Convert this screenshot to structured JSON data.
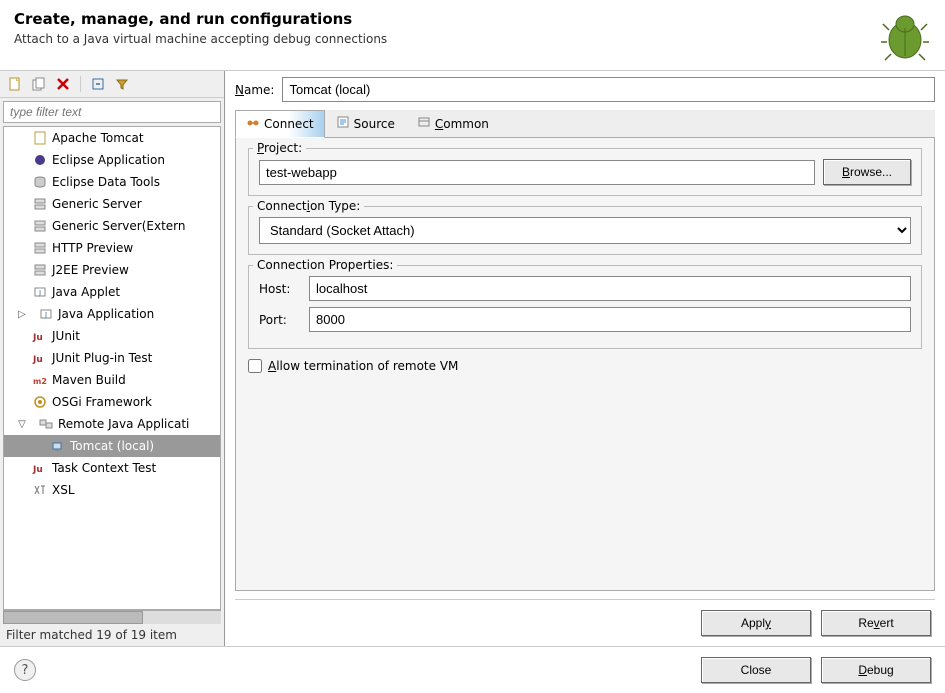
{
  "header": {
    "title": "Create, manage, and run configurations",
    "subtitle": "Attach to a Java virtual machine accepting debug connections"
  },
  "sidebar": {
    "filter_placeholder": "type filter text",
    "items": [
      {
        "label": "Apache Tomcat",
        "level": 0
      },
      {
        "label": "Eclipse Application",
        "level": 0
      },
      {
        "label": "Eclipse Data Tools",
        "level": 0
      },
      {
        "label": "Generic Server",
        "level": 0
      },
      {
        "label": "Generic Server(Extern",
        "level": 0
      },
      {
        "label": "HTTP Preview",
        "level": 0
      },
      {
        "label": "J2EE Preview",
        "level": 0
      },
      {
        "label": "Java Applet",
        "level": 0
      },
      {
        "label": "Java Application",
        "level": 0,
        "expandable": true,
        "expanded": false
      },
      {
        "label": "JUnit",
        "level": 0
      },
      {
        "label": "JUnit Plug-in Test",
        "level": 0
      },
      {
        "label": "Maven Build",
        "level": 0
      },
      {
        "label": "OSGi Framework",
        "level": 0
      },
      {
        "label": "Remote Java Applicati",
        "level": 0,
        "expandable": true,
        "expanded": true
      },
      {
        "label": "Tomcat (local)",
        "level": 1,
        "selected": true
      },
      {
        "label": "Task Context Test",
        "level": 0
      },
      {
        "label": "XSL",
        "level": 0
      }
    ],
    "filter_status": "Filter matched 19 of 19 item"
  },
  "form": {
    "name_label": "Name:",
    "name_value": "Tomcat (local)",
    "tabs": [
      {
        "id": "connect",
        "label": "Connect",
        "active": true
      },
      {
        "id": "source",
        "label": "Source",
        "active": false
      },
      {
        "id": "common",
        "label": "Common",
        "active": false
      }
    ],
    "project": {
      "label": "Project:",
      "value": "test-webapp",
      "browse": "Browse..."
    },
    "conn_type": {
      "label": "Connection Type:",
      "value": "Standard (Socket Attach)"
    },
    "conn_props": {
      "label": "Connection Properties:",
      "host_label": "Host:",
      "host_value": "localhost",
      "port_label": "Port:",
      "port_value": "8000"
    },
    "allow_terminate_label": "Allow termination of remote VM",
    "allow_terminate_checked": false,
    "apply": "Apply",
    "revert": "Revert"
  },
  "footer": {
    "close": "Close",
    "debug": "Debug"
  }
}
